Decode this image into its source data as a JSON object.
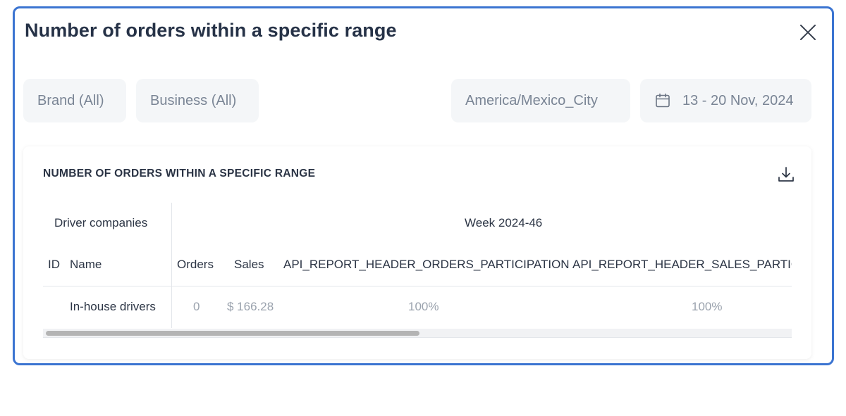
{
  "modal": {
    "title": "Number of orders within a specific range",
    "close_icon": "close-icon"
  },
  "filters": {
    "brand": "Brand (All)",
    "business": "Business (All)",
    "timezone": "America/Mexico_City",
    "date_range": "13 - 20 Nov, 2024",
    "date_icon": "calendar-icon"
  },
  "report": {
    "title": "NUMBER OF ORDERS WITHIN A SPECIFIC RANGE",
    "download_icon": "download-icon",
    "group_header_left": "Driver companies",
    "group_header_right": "Week 2024-46",
    "columns": {
      "id": "ID",
      "name": "Name",
      "orders": "Orders",
      "sales": "Sales",
      "orders_participation": "API_REPORT_HEADER_ORDERS_PARTICIPATION",
      "sales_participation": "API_REPORT_HEADER_SALES_PARTIC"
    },
    "rows": [
      {
        "id": "",
        "name": "In-house drivers",
        "orders": "0",
        "sales": "$ 166.28",
        "orders_participation": "100%",
        "sales_participation": "100%"
      }
    ],
    "scroll_position": 0.0
  },
  "colors": {
    "modal_border": "#3b74d1",
    "filter_bg": "#f4f6f8",
    "title_text": "#263247",
    "muted_text": "#9aa2ad"
  }
}
